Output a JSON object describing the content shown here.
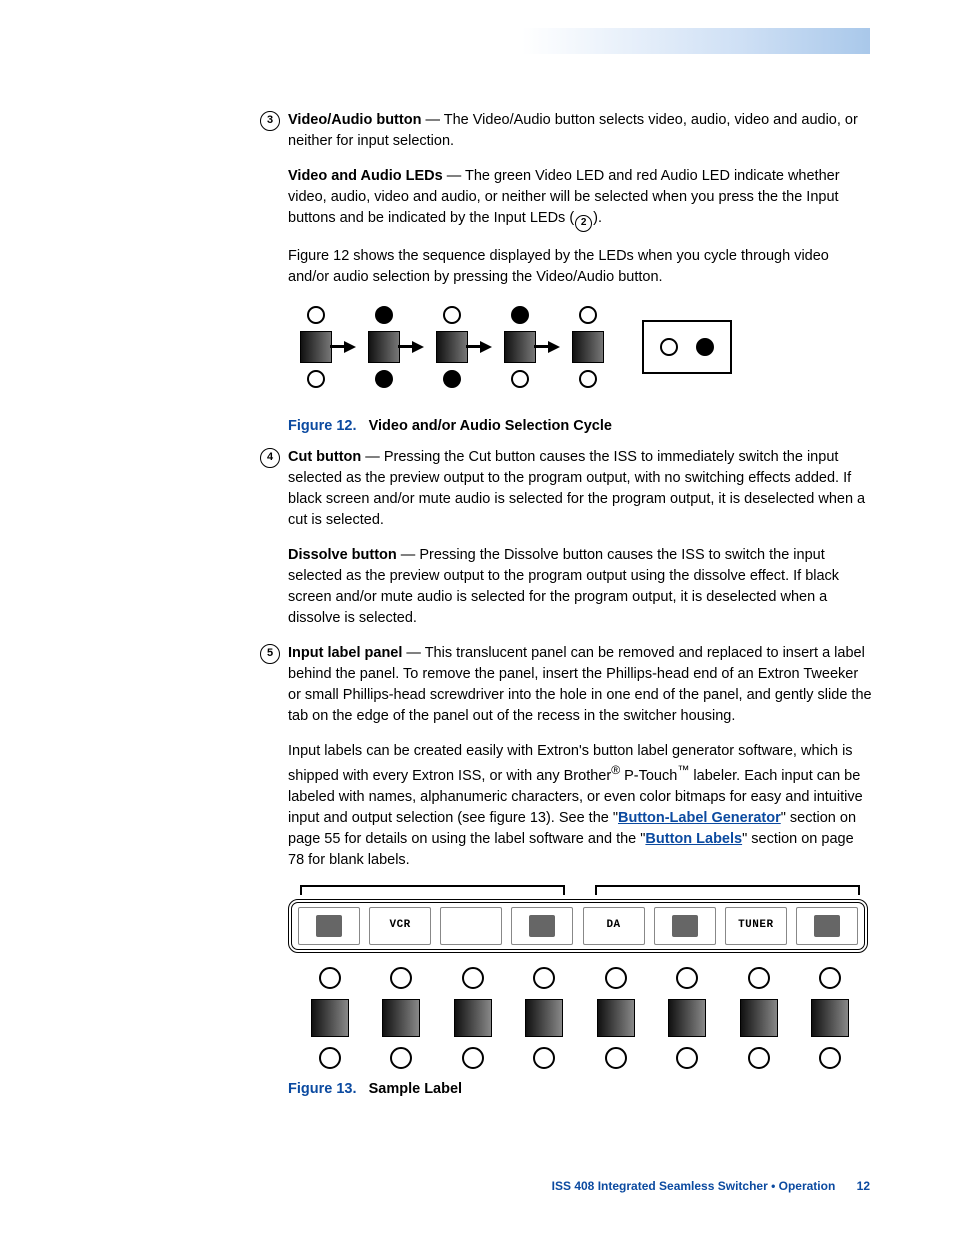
{
  "item3": {
    "videoAudioBtn": {
      "term": "Video/Audio button",
      "text": " — The Video/Audio button selects video, audio, video and audio, or neither for input selection."
    },
    "videoAudioLEDs": {
      "term": "Video and Audio LEDs",
      "text_before": " — The green Video LED and red Audio LED indicate whether video, audio, video and audio, or neither will be selected when you press the the Input buttons and be indicated by the Input LEDs (",
      "ref": "2",
      "text_after": ")."
    },
    "fig12intro": "Figure 12 shows the sequence displayed by the LEDs when you cycle through video and/or audio selection by pressing the Video/Audio button."
  },
  "fig12": {
    "label": "Figure 12.",
    "title": "Video and/or Audio Selection Cycle"
  },
  "item4": {
    "cut": {
      "term": "Cut button",
      "text": " — Pressing the Cut button causes the ISS to immediately switch the input selected as the preview output to the program output, with no switching effects added. If black screen and/or mute audio is selected for the program output, it is deselected when a cut is selected."
    },
    "dissolve": {
      "term": "Dissolve button",
      "text": " — Pressing the Dissolve button causes the ISS to switch the input selected as the preview output to the program output using the dissolve effect. If black screen and/or mute audio is selected for the program output, it is deselected when a dissolve is selected."
    }
  },
  "item5": {
    "panel": {
      "term": "Input label panel",
      "text": " — This translucent panel can be removed and replaced to insert a label behind the panel. To remove the panel, insert the Phillips-head end of an Extron Tweeker or small Phillips-head screwdriver into the hole in one end of the panel, and gently slide the tab on the edge of the panel out of the recess in the switcher housing."
    },
    "labels": {
      "pre": "Input labels can be created easily with Extron's button label generator software, which is shipped with every Extron ISS, or with any Brother",
      "reg": "®",
      "mid1": " P-Touch",
      "tm": "™",
      "mid2": " labeler. Each input can be labeled with names, alphanumeric characters, or even color bitmaps for easy and intuitive input and output selection (see figure 13). See the \"",
      "link1": "Button-Label Generator",
      "after1": "\" section on page 55 for details on using the label software and the \"",
      "link2": "Button Labels",
      "after2": "\" section on page 78 for blank labels."
    }
  },
  "fig13": {
    "label": "Figure 13.",
    "title": "Sample Label",
    "slots": [
      "",
      "VCR",
      "",
      "",
      "DA",
      "",
      "TUNER",
      ""
    ]
  },
  "footer": {
    "text": "ISS 408 Integrated Seamless Switcher • Operation",
    "page": "12"
  },
  "callouts": {
    "c3": "3",
    "c4": "4",
    "c5": "5"
  }
}
